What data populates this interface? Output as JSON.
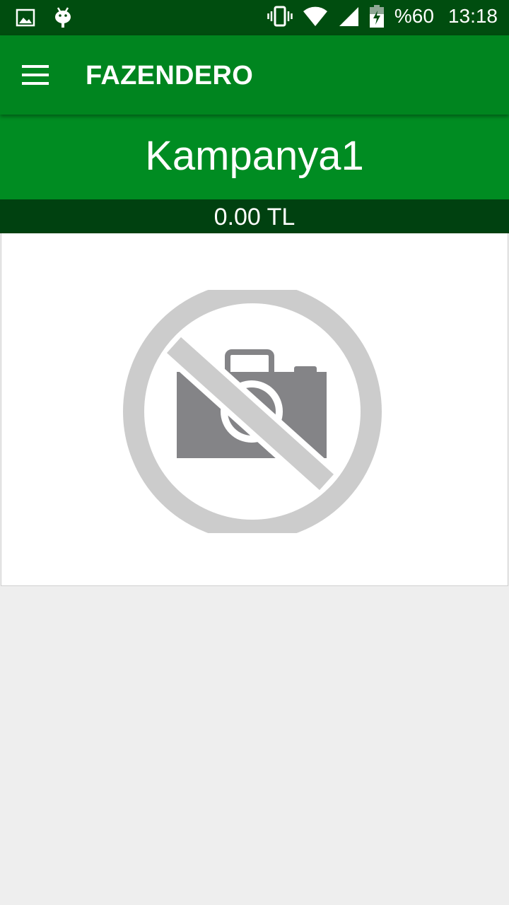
{
  "status_bar": {
    "left_icons": [
      "image-icon",
      "android-icon"
    ],
    "right_icons": [
      "vibrate-icon",
      "wifi-icon",
      "signal-icon",
      "battery-charging-icon"
    ],
    "battery": "%60",
    "time": "13:18"
  },
  "app_bar": {
    "menu_icon": "hamburger-menu-icon",
    "title": "FAZENDERO"
  },
  "campaign": {
    "title": "Kampanya1",
    "price": "0.00 TL",
    "image_icon": "no-photo-icon"
  },
  "colors": {
    "status_bar": "#004d0f",
    "app_bar": "#00851f",
    "campaign_header": "#008c22",
    "price_bar": "#004110",
    "background": "#eeeeee"
  }
}
